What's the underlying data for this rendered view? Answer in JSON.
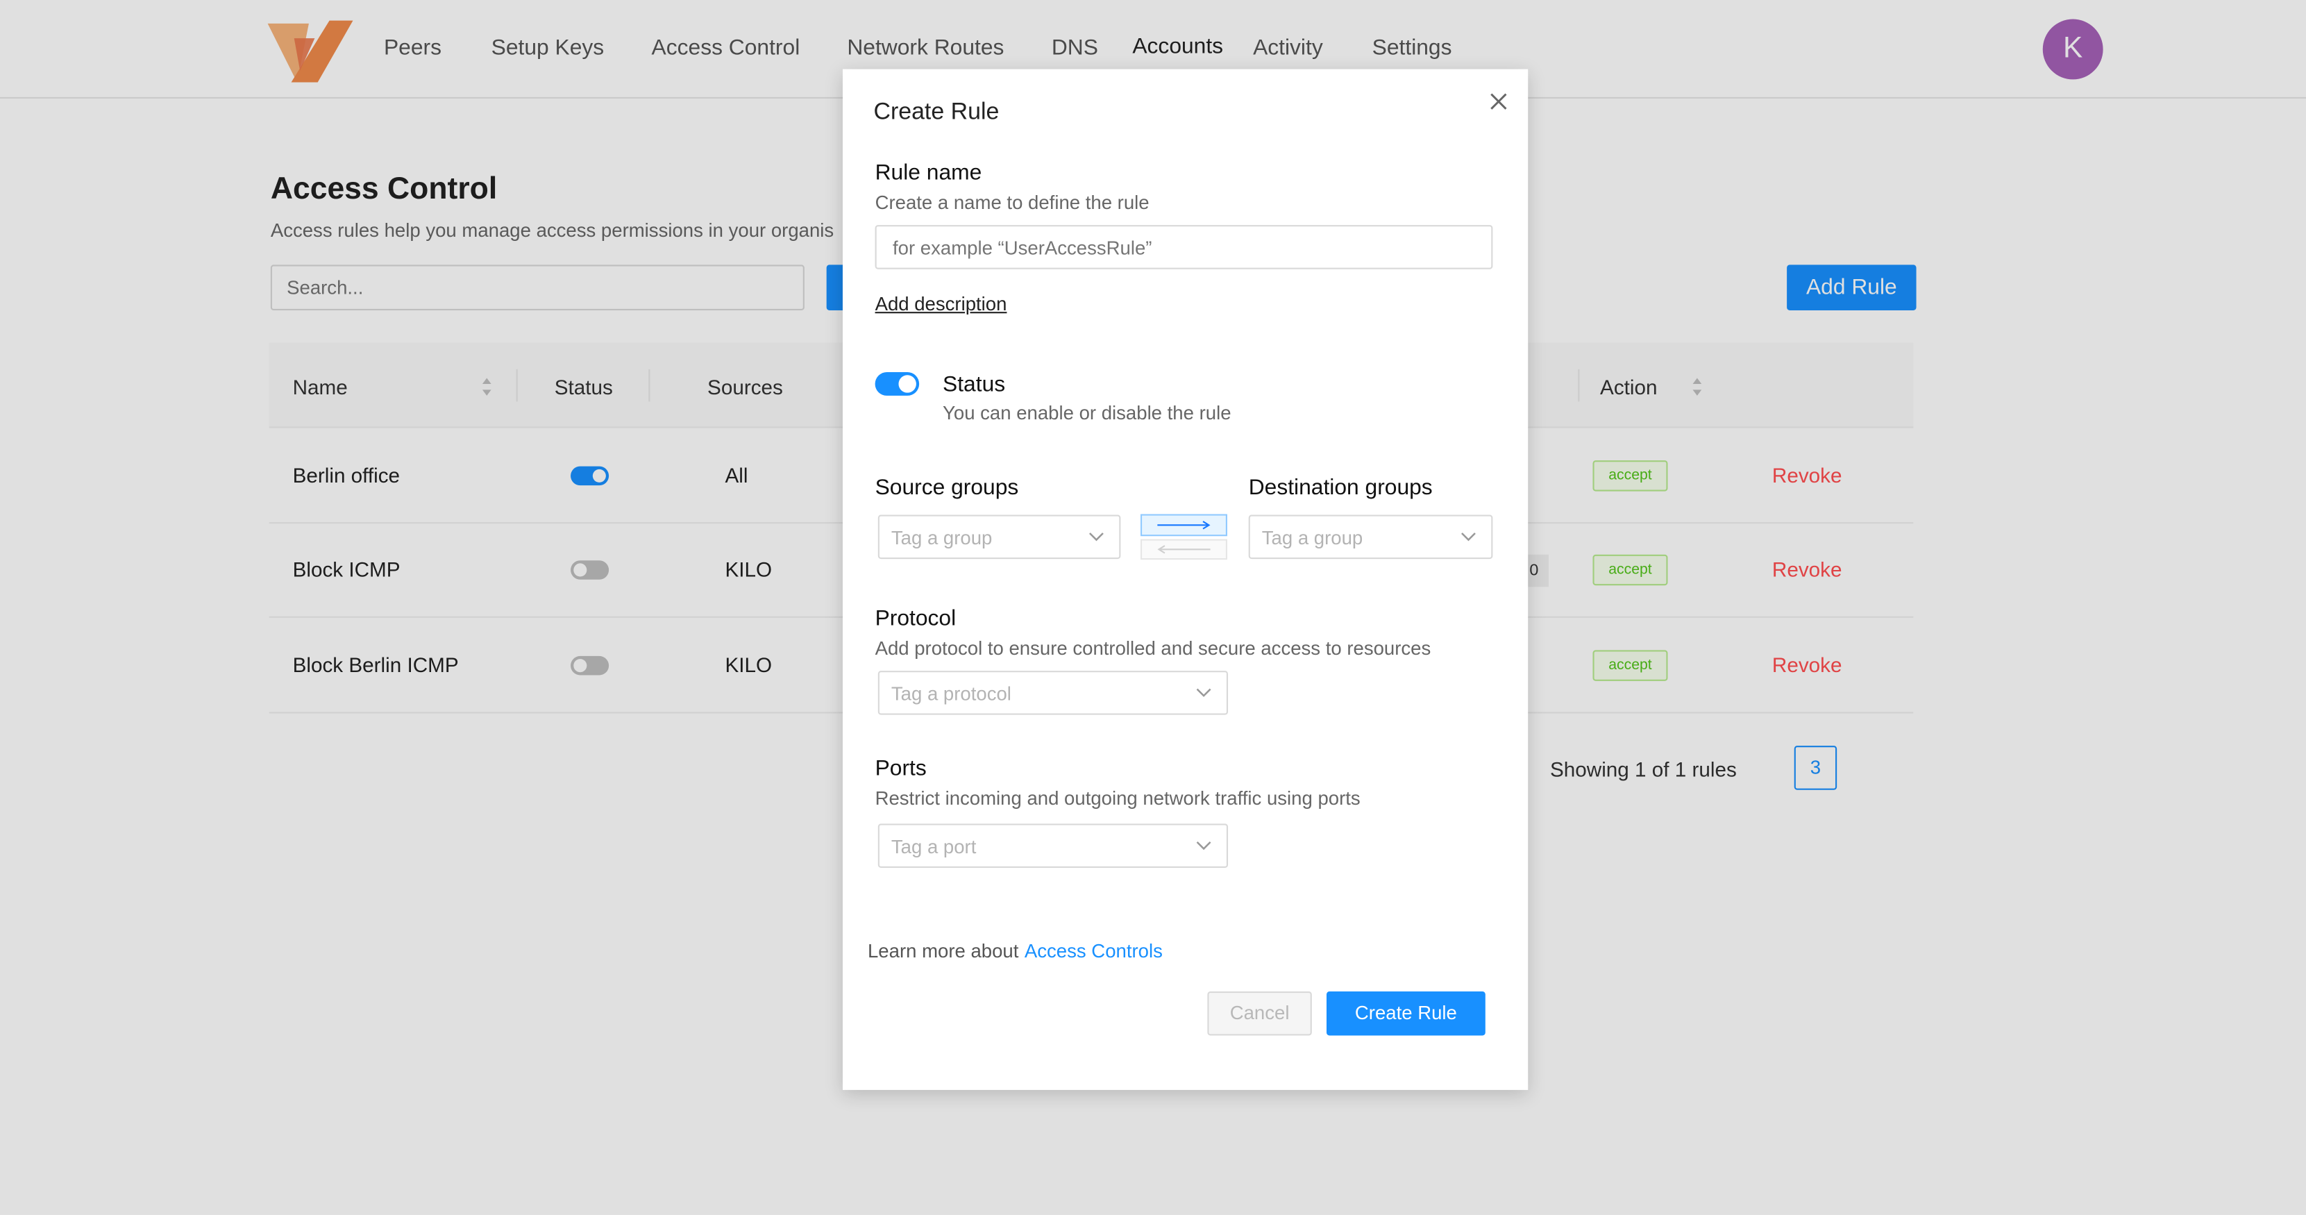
{
  "nav": {
    "items": [
      "Peers",
      "Setup Keys",
      "Access Control",
      "Network Routes",
      "DNS",
      "Accounts",
      "Activity",
      "Settings"
    ],
    "active": "Accounts",
    "avatar_letter": "K"
  },
  "page": {
    "title": "Access Control",
    "subtitle": "Access rules help you manage access permissions in your organis",
    "search_placeholder": "Search...",
    "add_rule_label": "Add Rule"
  },
  "table": {
    "headers": {
      "name": "Name",
      "status": "Status",
      "sources": "Sources",
      "action": "Action"
    },
    "rows": [
      {
        "name": "Berlin office",
        "enabled": true,
        "sources": "All",
        "action": "accept",
        "revoke": "Revoke"
      },
      {
        "name": "Block ICMP",
        "enabled": false,
        "sources": "KILO",
        "action": "accept",
        "revoke": "Revoke",
        "extra_tag": "0"
      },
      {
        "name": "Block Berlin ICMP",
        "enabled": false,
        "sources": "KILO",
        "action": "accept",
        "revoke": "Revoke"
      }
    ],
    "showing": "Showing 1 of 1 rules",
    "current_page": "3"
  },
  "modal": {
    "title": "Create Rule",
    "rule_name": {
      "label": "Rule name",
      "help": "Create a name to define the rule",
      "placeholder": "for example “UserAccessRule”"
    },
    "add_description": "Add description",
    "status": {
      "label": "Status",
      "help": "You can enable or disable the rule",
      "enabled": true
    },
    "source_groups": {
      "label": "Source groups",
      "placeholder": "Tag a group"
    },
    "destination_groups": {
      "label": "Destination groups",
      "placeholder": "Tag a group"
    },
    "protocol": {
      "label": "Protocol",
      "help": "Add protocol to ensure controlled and secure access to resources",
      "placeholder": "Tag a protocol"
    },
    "ports": {
      "label": "Ports",
      "help": "Restrict incoming and outgoing network traffic using ports",
      "placeholder": "Tag a port"
    },
    "learn_more": "Learn more about",
    "learn_link": "Access Controls",
    "cancel_label": "Cancel",
    "create_label": "Create Rule"
  },
  "colors": {
    "primary": "#1890ff",
    "avatar": "#a661b8",
    "revoke": "#ff4d4f",
    "accept": "#52c41a",
    "logo_orange": "#f08a4b"
  },
  "icons": [
    "logo-icon",
    "sort-icon",
    "close-icon",
    "chevron-down-icon",
    "direction-arrow-icon"
  ]
}
